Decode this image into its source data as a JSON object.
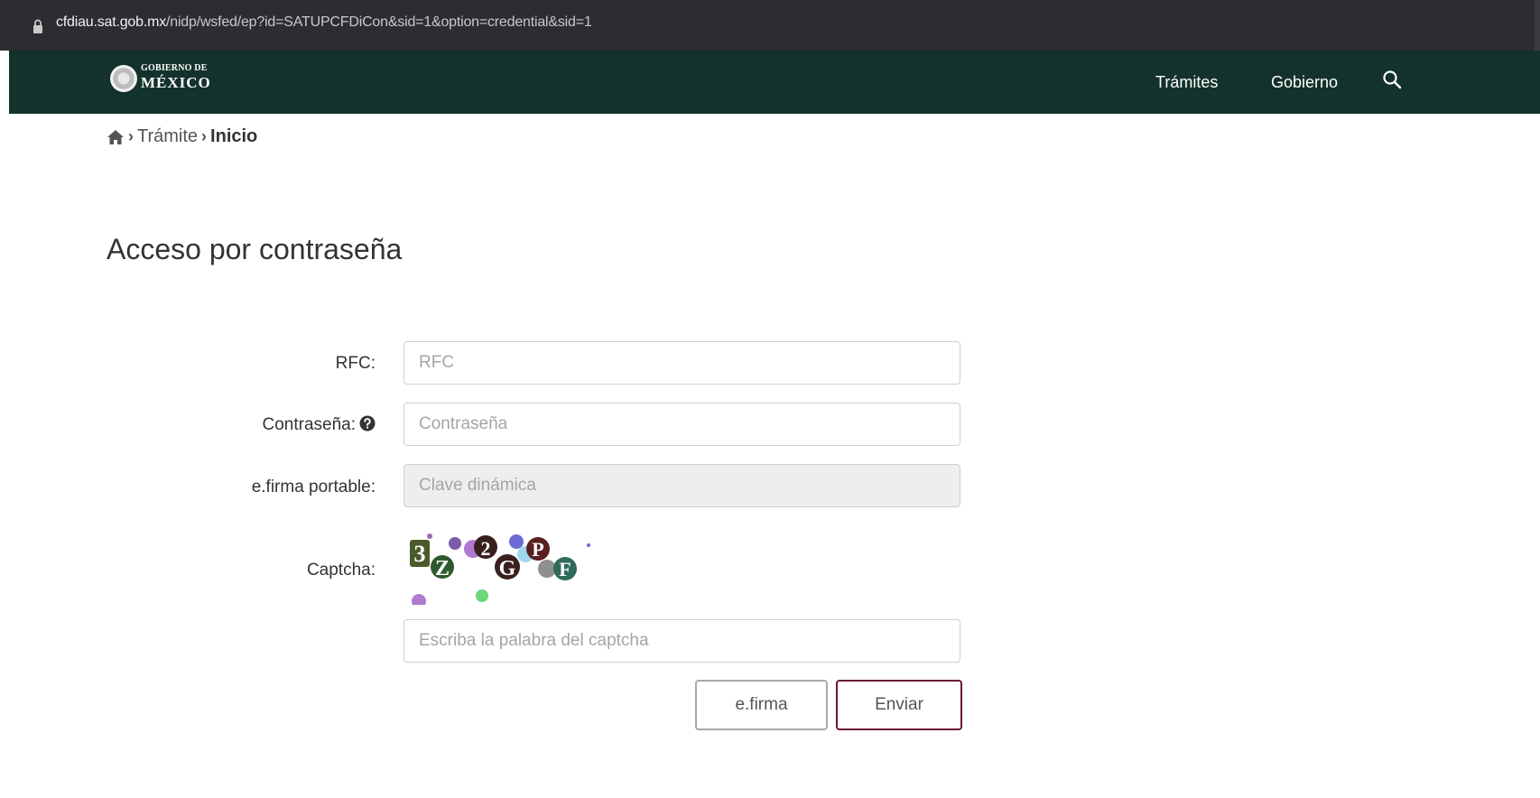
{
  "browser": {
    "url_host": "cfdiau.sat.gob.mx",
    "url_path": "/nidp/wsfed/ep?id=SATUPCFDiCon&sid=1&option=credential&sid=1",
    "lock_icon": "lock-icon"
  },
  "header": {
    "brand_line1": "GOBIERNO DE",
    "brand_line2": "MÉXICO",
    "nav": [
      "Trámites",
      "Gobierno"
    ],
    "search_icon": "search-icon",
    "bg_color": "#13322b"
  },
  "breadcrumb": {
    "home_icon": "home-icon",
    "items": [
      "Trámite",
      "Inicio"
    ]
  },
  "page_title": "Acceso por contraseña",
  "form": {
    "rfc_label": "RFC:",
    "rfc_placeholder": "RFC",
    "rfc_value": "",
    "password_label": "Contraseña:",
    "password_placeholder": "Contraseña",
    "password_value": "",
    "efirma_label": "e.firma portable:",
    "efirma_placeholder": "Clave dinámica",
    "captcha_label": "Captcha:",
    "captcha_text": "3Z2GPF",
    "captcha_input_placeholder": "Escriba la palabra del captcha",
    "captcha_value": ""
  },
  "buttons": {
    "efirma": "e.firma",
    "enviar": "Enviar",
    "enviar_border_color": "#6b1637"
  }
}
